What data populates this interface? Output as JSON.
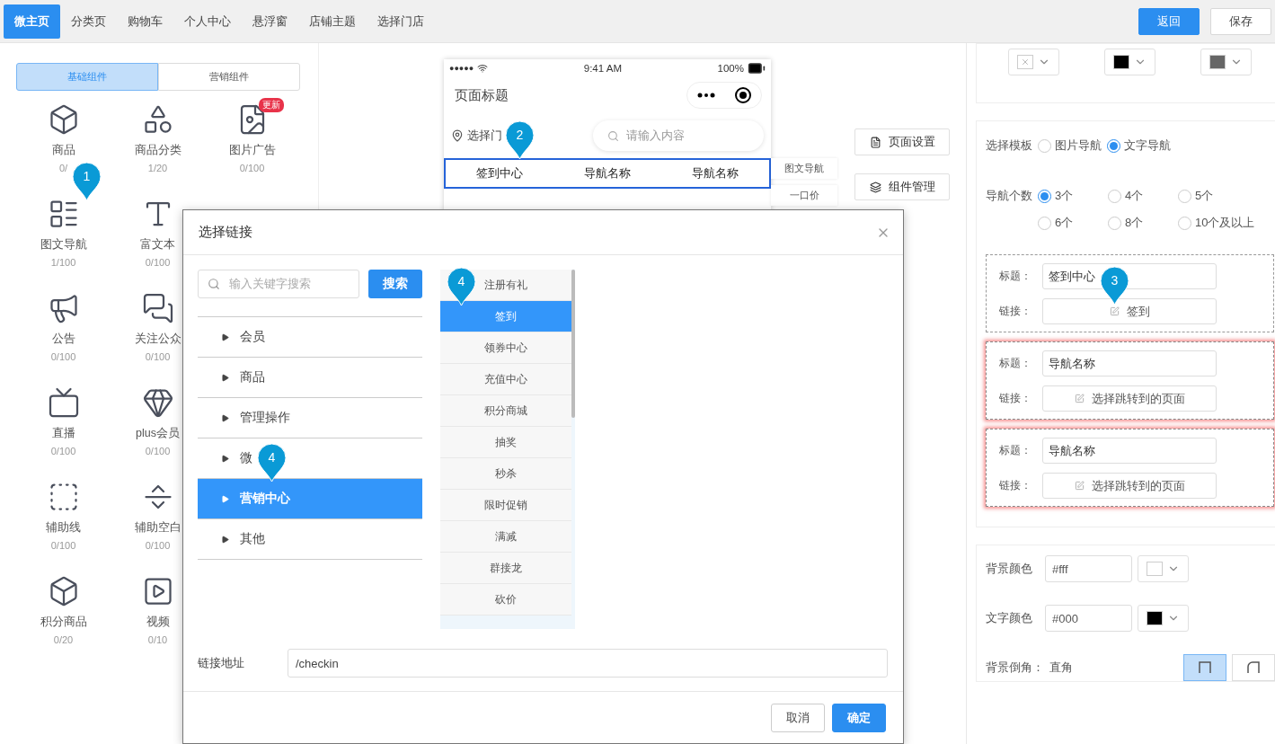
{
  "top_tabs": [
    {
      "label": "微主页",
      "selected": true
    },
    {
      "label": "分类页",
      "selected": false
    },
    {
      "label": "购物车",
      "selected": false
    },
    {
      "label": "个人中心",
      "selected": false
    },
    {
      "label": "悬浮窗",
      "selected": false
    },
    {
      "label": "店铺主题",
      "selected": false
    },
    {
      "label": "选择门店",
      "selected": false
    }
  ],
  "top_buttons": [
    {
      "label": "返回",
      "kind": "primary"
    },
    {
      "label": "保存",
      "kind": "default"
    }
  ],
  "palette": {
    "segments": [
      {
        "label": "基础组件",
        "selected": true
      },
      {
        "label": "营销组件",
        "selected": false
      }
    ],
    "rows": [
      [
        {
          "name": "商品",
          "count": "0/"
        },
        {
          "name": "商品分类",
          "count": "1/20"
        },
        {
          "name": "图片广告",
          "count": "0/100",
          "badge": "更新"
        }
      ],
      [
        {
          "name": "图文导航",
          "count": "1/100"
        },
        {
          "name": "富文本",
          "count": "0/100"
        }
      ],
      [
        {
          "name": "公告",
          "count": "0/100"
        },
        {
          "name": "关注公众",
          "count": "0/100"
        }
      ],
      [
        {
          "name": "直播",
          "count": "0/100"
        },
        {
          "name": "plus会员",
          "count": "0/100"
        }
      ],
      [
        {
          "name": "辅助线",
          "count": "0/100"
        },
        {
          "name": "辅助空白",
          "count": "0/100"
        }
      ],
      [
        {
          "name": "积分商品",
          "count": "0/20"
        },
        {
          "name": "视频",
          "count": "0/10"
        }
      ]
    ]
  },
  "phone": {
    "signal": "●●●●●",
    "time": "9:41 AM",
    "battery": "100%",
    "title": "页面标题",
    "store": "选择门",
    "search_placeholder": "请输入内容",
    "nav": [
      "签到中心",
      "导航名称",
      "导航名称"
    ]
  },
  "side_tags": [
    "图文导航",
    "一口价"
  ],
  "tools": [
    "页面设置",
    "组件管理"
  ],
  "settings": {
    "top_pickers": [
      {
        "kind": "none"
      },
      {
        "kind": "swatch",
        "color": "#000000"
      },
      {
        "kind": "swatch",
        "color": "#666666"
      }
    ],
    "template": {
      "label": "选择模板",
      "options": [
        {
          "label": "图片导航",
          "selected": false
        },
        {
          "label": "文字导航",
          "selected": true
        }
      ]
    },
    "count": {
      "label": "导航个数",
      "options": [
        {
          "label": "3个",
          "selected": true
        },
        {
          "label": "4个",
          "selected": false
        },
        {
          "label": "5个",
          "selected": false
        },
        {
          "label": "6个",
          "selected": false
        },
        {
          "label": "8个",
          "selected": false
        },
        {
          "label": "10个及以上",
          "selected": false
        }
      ]
    },
    "nav_items": [
      {
        "title_label": "标题：",
        "title": "签到中心",
        "link_label": "链接：",
        "link": "签到",
        "invalid": false
      },
      {
        "title_label": "标题：",
        "title": "导航名称",
        "link_label": "链接：",
        "link": "选择跳转到的页面",
        "invalid": true
      },
      {
        "title_label": "标题：",
        "title": "导航名称",
        "link_label": "链接：",
        "link": "选择跳转到的页面",
        "invalid": true
      }
    ],
    "colors": [
      {
        "label": "背景颜色",
        "value": "#fff",
        "color": "#ffffff"
      },
      {
        "label": "文字颜色",
        "value": "#000",
        "color": "#000000"
      }
    ],
    "corner": {
      "label": "背景倒角：",
      "value": "直角",
      "options": [
        {
          "selected": true
        },
        {
          "selected": false
        }
      ]
    }
  },
  "modal": {
    "title": "选择链接",
    "search": {
      "placeholder": "输入关键字搜索",
      "button": "搜索"
    },
    "categories": [
      {
        "label": "会员",
        "selected": false
      },
      {
        "label": "商品",
        "selected": false
      },
      {
        "label": "管理操作",
        "selected": false
      },
      {
        "label": "微",
        "selected": false
      },
      {
        "label": "营销中心",
        "selected": true
      },
      {
        "label": "其他",
        "selected": false
      }
    ],
    "links": [
      {
        "label": "注册有礼",
        "selected": false
      },
      {
        "label": "签到",
        "selected": true
      },
      {
        "label": "领券中心",
        "selected": false
      },
      {
        "label": "充值中心",
        "selected": false
      },
      {
        "label": "积分商城",
        "selected": false
      },
      {
        "label": "抽奖",
        "selected": false
      },
      {
        "label": "秒杀",
        "selected": false
      },
      {
        "label": "限时促销",
        "selected": false
      },
      {
        "label": "满减",
        "selected": false
      },
      {
        "label": "群接龙",
        "selected": false
      },
      {
        "label": "砍价",
        "selected": false
      }
    ],
    "address": {
      "label": "链接地址",
      "value": "/checkin"
    },
    "buttons": [
      {
        "label": "取消",
        "kind": "default"
      },
      {
        "label": "确定",
        "kind": "primary"
      }
    ]
  },
  "markers": [
    "1",
    "2",
    "3",
    "4",
    "4"
  ]
}
